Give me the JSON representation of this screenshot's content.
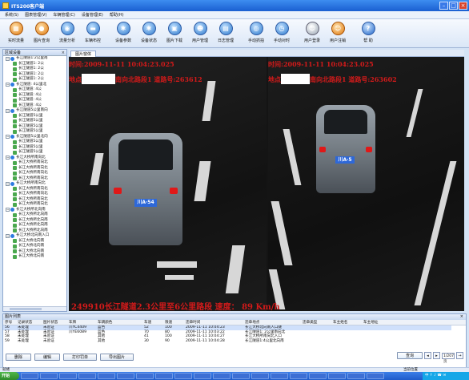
{
  "window": {
    "title": "ITS200客户端"
  },
  "menu": [
    "系统(S)",
    "图表管理(V)",
    "车辆管理(C)",
    "设备管理(E)",
    "帮助(H)"
  ],
  "toolbar": [
    {
      "label": "实时流量",
      "icon": "realtime-flow-icon"
    },
    {
      "label": "图片查询",
      "icon": "image-search-icon"
    },
    {
      "label": "流量分析",
      "icon": "flow-analysis-icon"
    },
    {
      "label": "车辆布控",
      "icon": "vehicle-control-icon"
    },
    {
      "label": "设备参数",
      "icon": "device-params-icon"
    },
    {
      "label": "设备状态",
      "icon": "device-status-icon"
    },
    {
      "label": "图片下载",
      "icon": "image-download-icon"
    },
    {
      "label": "用户管理",
      "icon": "user-management-icon"
    },
    {
      "label": "日志管理",
      "icon": "log-management-icon"
    },
    {
      "label": "手动抓拍",
      "icon": "manual-capture-icon"
    },
    {
      "label": "手动对时",
      "icon": "manual-time-sync-icon"
    },
    {
      "label": "用户登录",
      "icon": "user-login-icon"
    },
    {
      "label": "用户注销",
      "icon": "user-logout-icon"
    },
    {
      "label": "帮 助",
      "icon": "help-icon"
    }
  ],
  "tree": {
    "header": "区域设备",
    "groups": [
      {
        "label": "长江隧道1:2公里南",
        "devices": [
          "长江隧道1: 2公",
          "长江隧道1: 2公",
          "长江隧道1: 2公",
          "长江隧道1: 2公"
        ]
      },
      {
        "label": "长江隧道: 4公里北",
        "devices": [
          "长江隧道: 4公",
          "长江隧道: 4公",
          "长江隧道: 4公",
          "长江隧道: 4公"
        ]
      },
      {
        "label": "长江隧道5公里南向",
        "devices": [
          "长江隧道5公里",
          "长江隧道5公里",
          "长江隧道5公里",
          "长江隧道5公里"
        ]
      },
      {
        "label": "长江隧道5公里北向",
        "devices": [
          "长江隧道5公里",
          "长江隧道5公里",
          "长江隧道5公里"
        ]
      },
      {
        "label": "长江大桥所南向北",
        "devices": [
          "长江大桥所南向北",
          "长江大桥所南向北",
          "长江大桥所南向北",
          "长江大桥所南向北"
        ]
      },
      {
        "label": "长江大桥所南向北",
        "devices": [
          "长江大桥所南向北",
          "长江大桥所南向北",
          "长江大桥所南向北",
          "长江大桥所南向北"
        ]
      },
      {
        "label": "长江大桥所北向南",
        "devices": [
          "长江大桥所北向南",
          "长江大桥所北向南",
          "长江大桥所北向南",
          "长江大桥所北向南"
        ]
      },
      {
        "label": "长江大桥北向南入口",
        "devices": [
          "长江大桥北向南",
          "长江大桥北向南",
          "长江大桥北向南",
          "长江大桥北向南"
        ]
      }
    ]
  },
  "video": {
    "tab": "图片窗体",
    "left": {
      "line1": "时间:2009-11-11 10:04:23.025",
      "line2a": "地点:",
      "line2b": "南向北路段1 道路号:263612"
    },
    "right": {
      "line1": "时间:2009-11-11 10:04:23.025",
      "line2a": "地点:",
      "line2b": "南向北路段1 道路号:263602"
    },
    "plate_left": "川A·54",
    "plate_right": "川A·5",
    "caption": "249910长江隧道2.3公里至6公里路段  速度：  89 Km/h"
  },
  "list": {
    "header": "图片列表",
    "columns": [
      "序号",
      "记录状态",
      "图片状态",
      "车牌",
      "车辆颜色",
      "车速",
      "限速",
      "违章时间",
      "违章地点",
      "违章类型",
      "车主姓名",
      "车主地址"
    ],
    "rows": [
      [
        "56",
        "未处理",
        "未验证",
        "川YC4409",
        "蓝色",
        "52",
        "100",
        "2009-11-11 10:04:23",
        "长江大桥北向南入口隧",
        "",
        "",
        ""
      ],
      [
        "57",
        "未处理",
        "未验证",
        "川YE6089",
        "蓝色",
        "70",
        "80",
        "2009-11-11 10:03:22",
        "长江隧道1: 2公里南向北",
        "",
        "",
        ""
      ],
      [
        "58",
        "未处理",
        "未验证",
        "",
        "其他",
        "41",
        "100",
        "2009-11-11 10:04:27",
        "长江大桥所南向北入口",
        "",
        "",
        ""
      ],
      [
        "59",
        "未处理",
        "未验证",
        "",
        "其他",
        "30",
        "90",
        "2009-11-11 10:04:28",
        "长江隧道1:4公里北向南",
        "",
        "",
        ""
      ]
    ],
    "buttons": {
      "delete": "删除",
      "edit": "编辑",
      "print": "打印罚单",
      "export": "导出图片",
      "query": "查询"
    },
    "pager": {
      "value": "1/207页"
    }
  },
  "statusbar": {
    "text": "就绪",
    "right": "当前位置"
  },
  "taskbar": {
    "start": "开始",
    "items": [
      "",
      "",
      "",
      "",
      "",
      "",
      "",
      "",
      "",
      "",
      "",
      "",
      "",
      "",
      "",
      "",
      "",
      "",
      ""
    ],
    "tray": "中 ↑ ♪ ☎ ✉"
  },
  "colors": {
    "osd": "#d21a1a",
    "titlebar": "#1a5fd1",
    "plate": "#2e68d8"
  }
}
